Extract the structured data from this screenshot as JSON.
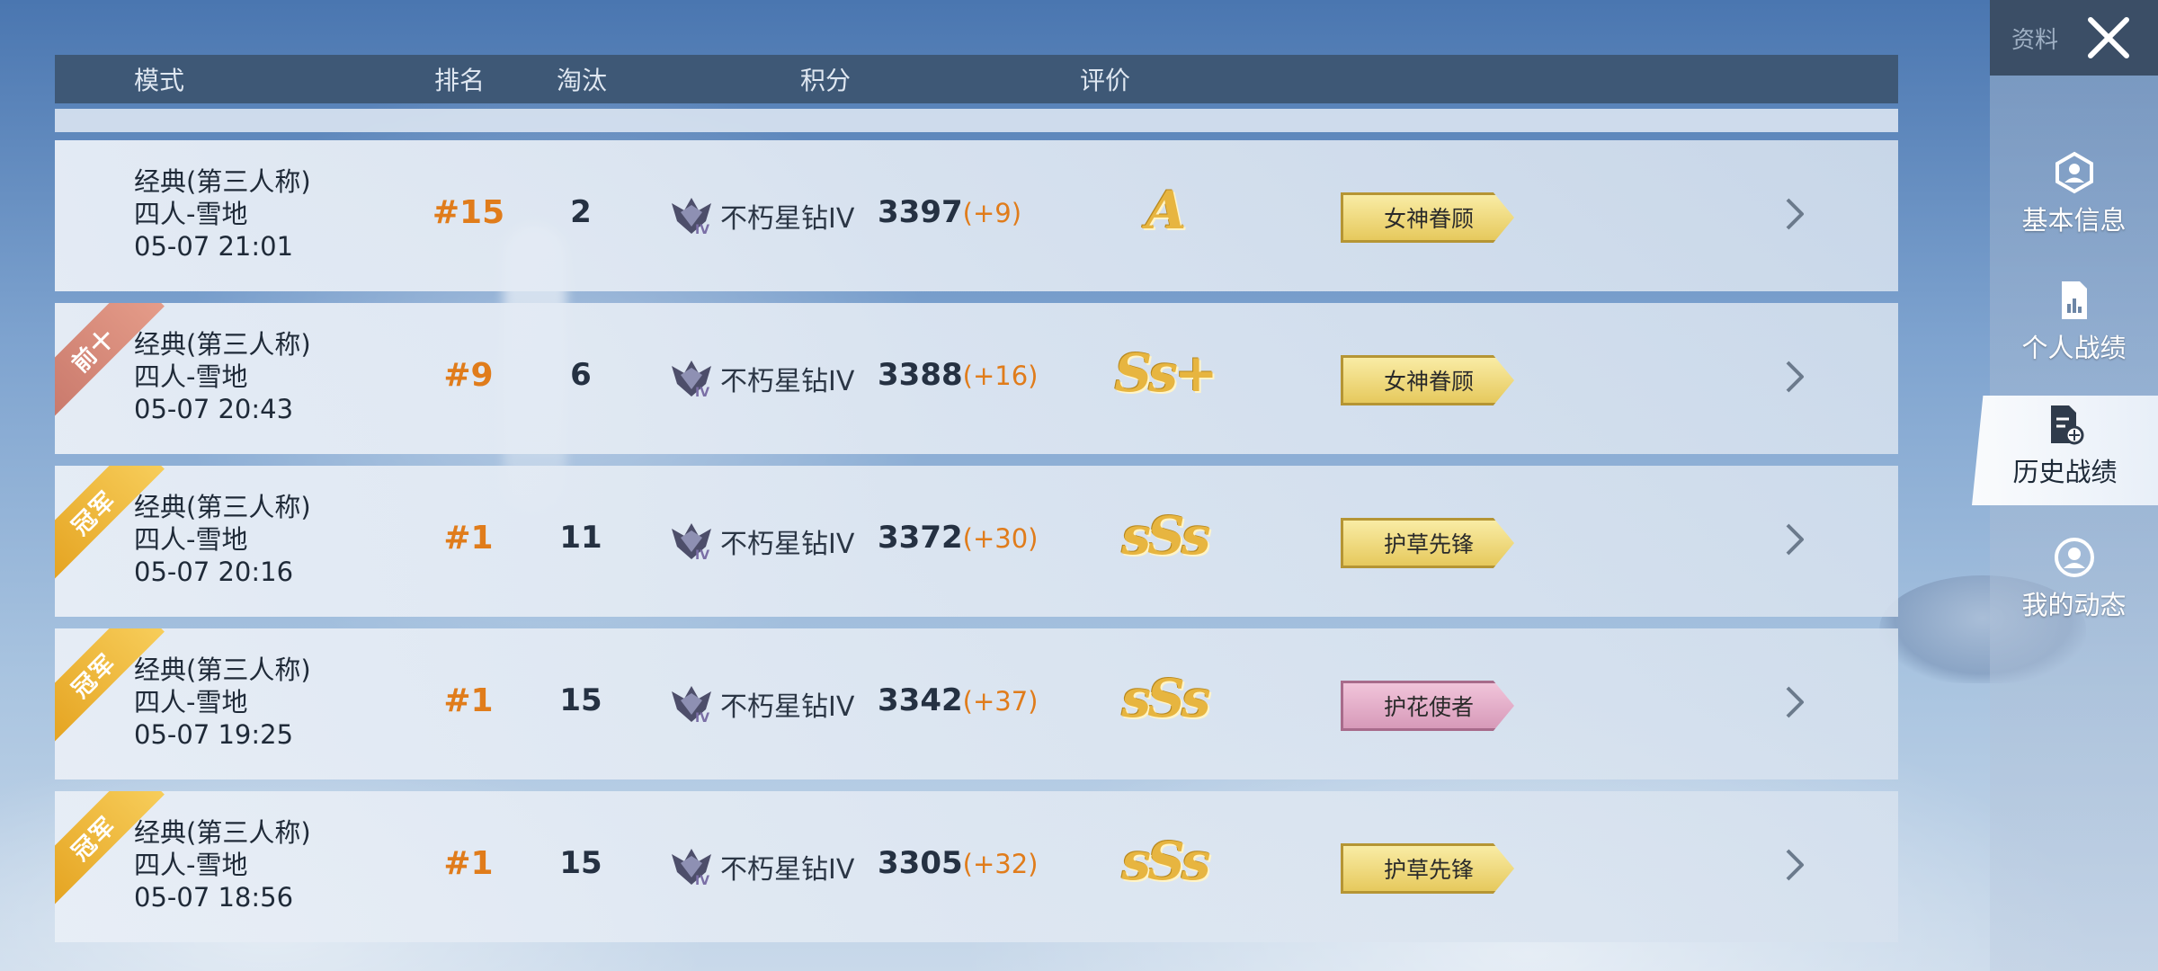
{
  "header": {
    "col_mode": "模式",
    "col_rank": "排名",
    "col_elim": "淘汰",
    "col_score": "积分",
    "col_rating": "评价"
  },
  "rows": [
    {
      "ribbon": "",
      "ribbon_type": "none",
      "mode": "经典(第三人称)",
      "map": "四人-雪地",
      "time": "05-07 21:01",
      "rank": "#15",
      "elims": "2",
      "tier": "不朽星钻IV",
      "score": "3397",
      "delta": "(+9)",
      "grade": "A",
      "badge": "女神眷顾",
      "badge_color": "gold"
    },
    {
      "ribbon": "前十",
      "ribbon_type": "top10",
      "mode": "经典(第三人称)",
      "map": "四人-雪地",
      "time": "05-07 20:43",
      "rank": "#9",
      "elims": "6",
      "tier": "不朽星钻IV",
      "score": "3388",
      "delta": "(+16)",
      "grade": "Ss+",
      "badge": "女神眷顾",
      "badge_color": "gold"
    },
    {
      "ribbon": "冠军",
      "ribbon_type": "gold",
      "mode": "经典(第三人称)",
      "map": "四人-雪地",
      "time": "05-07 20:16",
      "rank": "#1",
      "elims": "11",
      "tier": "不朽星钻IV",
      "score": "3372",
      "delta": "(+30)",
      "grade": "sSs",
      "badge": "护草先锋",
      "badge_color": "gold"
    },
    {
      "ribbon": "冠军",
      "ribbon_type": "gold",
      "mode": "经典(第三人称)",
      "map": "四人-雪地",
      "time": "05-07 19:25",
      "rank": "#1",
      "elims": "15",
      "tier": "不朽星钻IV",
      "score": "3342",
      "delta": "(+37)",
      "grade": "sSs",
      "badge": "护花使者",
      "badge_color": "pink"
    },
    {
      "ribbon": "冠军",
      "ribbon_type": "gold",
      "mode": "经典(第三人称)",
      "map": "四人-雪地",
      "time": "05-07 18:56",
      "rank": "#1",
      "elims": "15",
      "tier": "不朽星钻IV",
      "score": "3305",
      "delta": "(+32)",
      "grade": "sSs",
      "badge": "护草先锋",
      "badge_color": "gold"
    }
  ],
  "sidebar": {
    "top_label": "资料",
    "items": [
      {
        "label": "基本信息",
        "icon": "profile-hexagon-icon",
        "active": false
      },
      {
        "label": "个人战绩",
        "icon": "stats-document-icon",
        "active": false
      },
      {
        "label": "历史战绩",
        "icon": "history-document-icon",
        "active": true
      },
      {
        "label": "我的动态",
        "icon": "user-circle-icon",
        "active": false
      }
    ]
  },
  "colors": {
    "header_bg": "#3e5876",
    "rank_orange": "#e07c1b",
    "grade_gold": "#e7b540",
    "badge_gold": "#e6c95d",
    "badge_pink": "#d79ab9",
    "ribbon_gold": "#e4a21f",
    "ribbon_top10": "#c8786b"
  }
}
